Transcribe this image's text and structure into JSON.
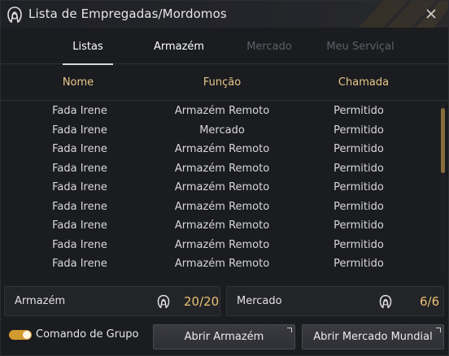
{
  "window": {
    "title": "Lista de Empregadas/Mordomos",
    "title_icon": "maid-icon",
    "close_icon": "close-icon"
  },
  "tabs": [
    {
      "label": "Listas",
      "state": "active"
    },
    {
      "label": "Armazém",
      "state": "normal"
    },
    {
      "label": "Mercado",
      "state": "disabled"
    },
    {
      "label": "Meu Serviçal",
      "state": "disabled"
    }
  ],
  "columns": {
    "name": "Nome",
    "function": "Função",
    "call": "Chamada"
  },
  "rows": [
    {
      "name": "Fada Irene",
      "function": "Armazém Remoto",
      "call": "Permitido"
    },
    {
      "name": "Fada Irene",
      "function": "Mercado",
      "call": "Permitido"
    },
    {
      "name": "Fada Irene",
      "function": "Armazém Remoto",
      "call": "Permitido"
    },
    {
      "name": "Fada Irene",
      "function": "Armazém Remoto",
      "call": "Permitido"
    },
    {
      "name": "Fada Irene",
      "function": "Armazém Remoto",
      "call": "Permitido"
    },
    {
      "name": "Fada Irene",
      "function": "Armazém Remoto",
      "call": "Permitido"
    },
    {
      "name": "Fada Irene",
      "function": "Armazém Remoto",
      "call": "Permitido"
    },
    {
      "name": "Fada Irene",
      "function": "Armazém Remoto",
      "call": "Permitido"
    },
    {
      "name": "Fada Irene",
      "function": "Armazém Remoto",
      "call": "Permitido"
    }
  ],
  "capacity": {
    "storage": {
      "label": "Armazém",
      "count": "20/20",
      "icon": "maid-icon"
    },
    "market": {
      "label": "Mercado",
      "count": "6/6",
      "icon": "maid-icon"
    }
  },
  "footer": {
    "group_command_label": "Comando de Grupo",
    "group_command_on": true,
    "open_storage_label": "Abrir Armazém",
    "open_market_label": "Abrir Mercado Mundial"
  },
  "colors": {
    "accent": "#e8c274",
    "header_text": "#e7c98a",
    "toggle": "#d39a2d"
  }
}
